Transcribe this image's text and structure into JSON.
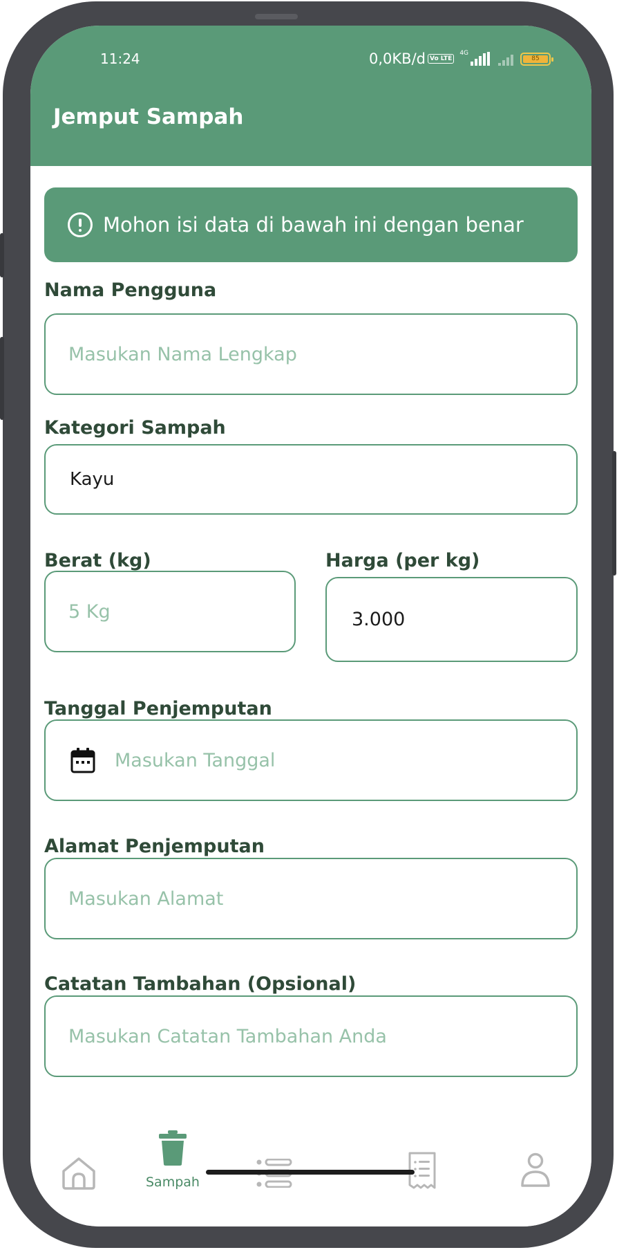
{
  "status_bar": {
    "time": "11:24",
    "network_speed": "0,0KB/d",
    "volte_badge": "Vo LTE",
    "network_type": "4G",
    "battery": "85"
  },
  "app_bar": {
    "title": "Jemput Sampah"
  },
  "alert": {
    "message": "Mohon isi data di bawah ini dengan benar",
    "icon": "info-circle-icon"
  },
  "form": {
    "name": {
      "label": "Nama Pengguna",
      "placeholder": "Masukan Nama Lengkap",
      "value": ""
    },
    "category": {
      "label": "Kategori Sampah",
      "value": "Kayu"
    },
    "weight": {
      "label": "Berat (kg)",
      "placeholder": "5 Kg",
      "value": ""
    },
    "price": {
      "label": "Harga (per kg)",
      "value": "3.000"
    },
    "date": {
      "label": "Tanggal Penjemputan",
      "placeholder": "Masukan Tanggal",
      "value": "",
      "icon": "calendar-icon"
    },
    "address": {
      "label": "Alamat Penjemputan",
      "placeholder": "Masukan Alamat",
      "value": ""
    },
    "notes": {
      "label": "Catatan Tambahan (Opsional)",
      "placeholder": "Masukan Catatan Tambahan Anda",
      "value": ""
    }
  },
  "bottom_nav": {
    "active": "Sampah",
    "items": [
      {
        "icon": "home-icon",
        "label": ""
      },
      {
        "icon": "trash-icon",
        "label": "Sampah"
      },
      {
        "icon": "list-icon",
        "label": ""
      },
      {
        "icon": "receipt-icon",
        "label": ""
      },
      {
        "icon": "profile-icon",
        "label": ""
      }
    ]
  },
  "colors": {
    "primary": "#5a9a78",
    "label_text": "#2f4a38",
    "placeholder": "#97c2a9",
    "nav_icon": "#b7b7b7",
    "frame": "#46474c"
  }
}
